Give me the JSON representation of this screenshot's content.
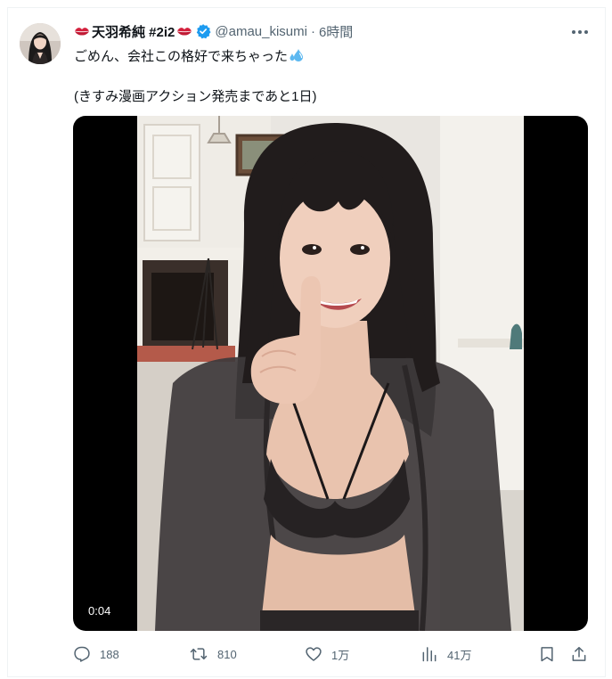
{
  "tweet": {
    "author": {
      "display_name": "天羽希純 #2i2",
      "handle": "@amau_kisumi",
      "separator": "·",
      "time": "6時間",
      "verified": true,
      "avatar_icon": "profile-photo"
    },
    "text": {
      "line1": "ごめん、会社この格好で来ちゃった",
      "line2": "(きすみ漫画アクション発売まであと1日)"
    },
    "emoji": {
      "name_decoration": "kiss-mark-lips",
      "line1_trailing": "sweat-droplets"
    },
    "media": {
      "type": "video",
      "timecode": "0:04",
      "thumbnail": "woman in sheer black robe and lingerie, finger to lips, indoor room"
    },
    "actions": {
      "replies": "188",
      "retweets": "810",
      "likes": "1万",
      "views": "41万"
    }
  },
  "colors": {
    "text": "#0f1419",
    "secondary": "#536471",
    "verified": "#1d9bf0",
    "border": "#eff3f4",
    "lips": "#d4213d"
  }
}
